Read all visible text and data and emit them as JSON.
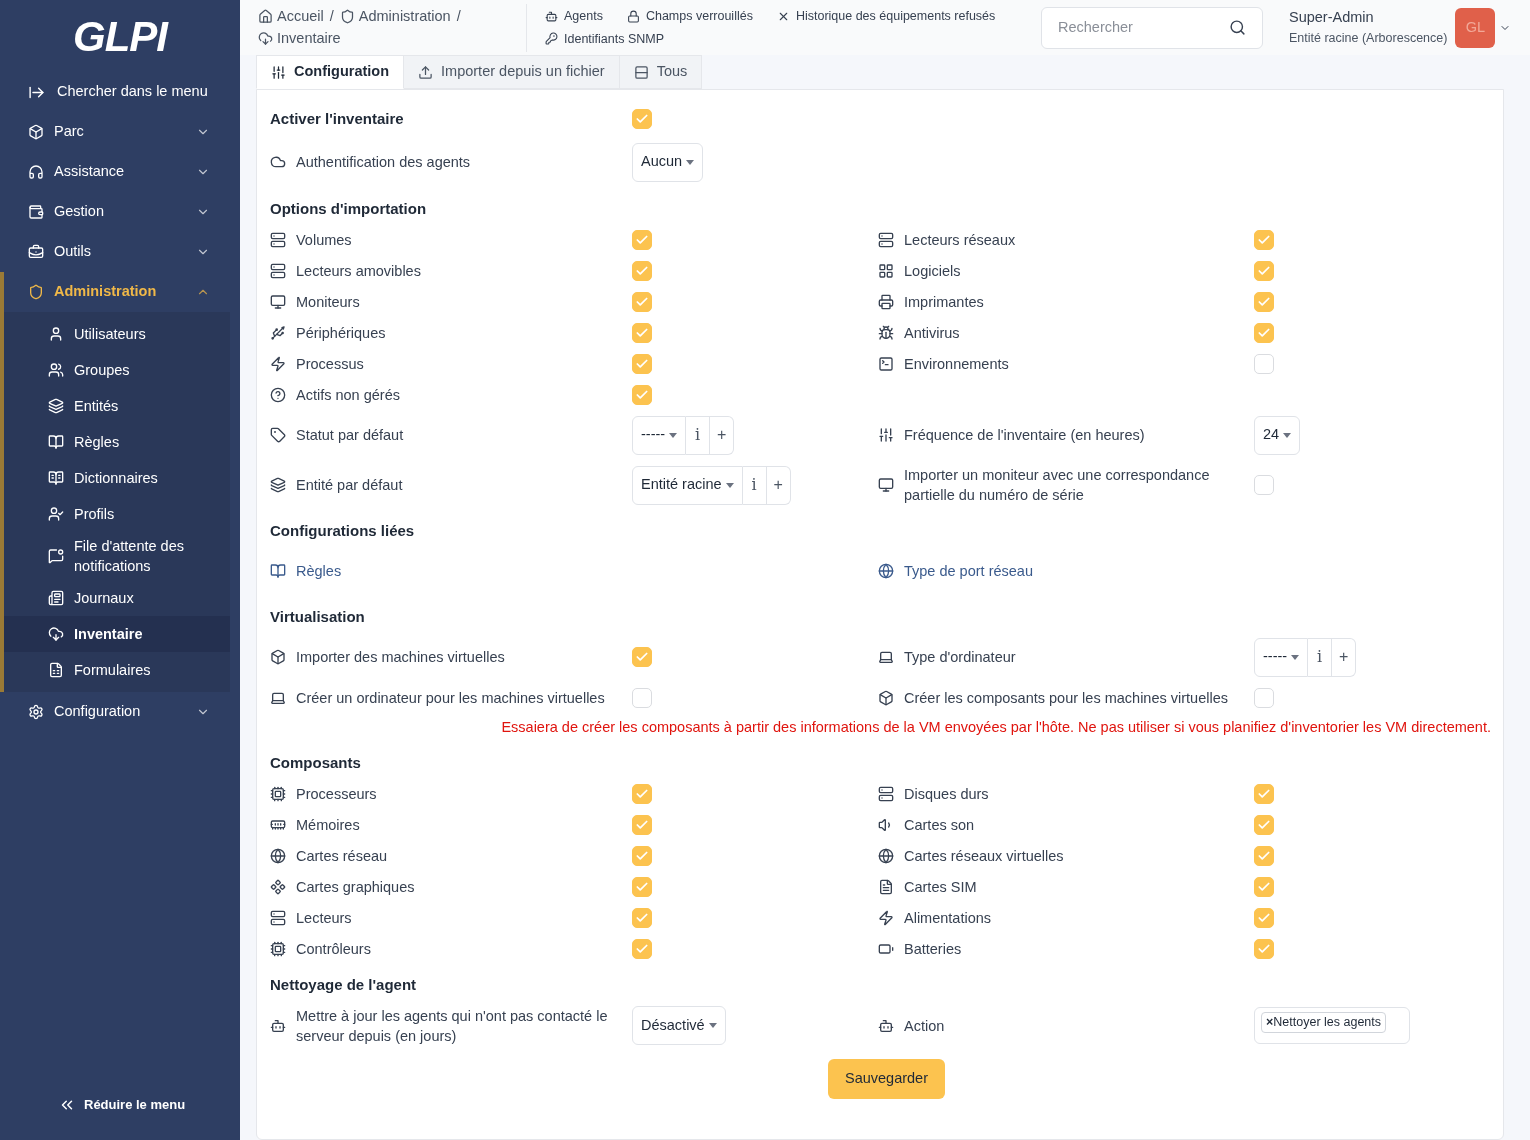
{
  "sidebar": {
    "logo": "GLPI",
    "search_label": "Chercher dans le menu",
    "items": [
      {
        "label": "Parc",
        "selected": false,
        "expanded": false
      },
      {
        "label": "Assistance",
        "selected": false,
        "expanded": false
      },
      {
        "label": "Gestion",
        "selected": false,
        "expanded": false
      },
      {
        "label": "Outils",
        "selected": false,
        "expanded": false
      },
      {
        "label": "Administration",
        "selected": true,
        "expanded": true,
        "children": [
          {
            "label": "Utilisateurs",
            "selected": false
          },
          {
            "label": "Groupes",
            "selected": false
          },
          {
            "label": "Entités",
            "selected": false
          },
          {
            "label": "Règles",
            "selected": false
          },
          {
            "label": "Dictionnaires",
            "selected": false
          },
          {
            "label": "Profils",
            "selected": false
          },
          {
            "label": "File d'attente des notifications",
            "selected": false
          },
          {
            "label": "Journaux",
            "selected": false
          },
          {
            "label": "Inventaire",
            "selected": true
          },
          {
            "label": "Formulaires",
            "selected": false
          }
        ]
      },
      {
        "label": "Configuration",
        "selected": false,
        "expanded": false
      }
    ],
    "collapse_label": "Réduire le menu"
  },
  "header": {
    "breadcrumbs": [
      "Accueil",
      "Administration",
      "Inventaire"
    ],
    "separator": "/",
    "links": [
      "Agents",
      "Champs verrouillés",
      "Historique des équipements refusés",
      "Identifiants SNMP"
    ],
    "search": {
      "placeholder": "Rechercher"
    },
    "user": {
      "name": "Super-Admin",
      "entity": "Entité racine (Arborescence)",
      "initials": "GL"
    }
  },
  "tabs": [
    {
      "label": "Configuration",
      "selected": true
    },
    {
      "label": "Importer depuis un fichier",
      "selected": false
    },
    {
      "label": "Tous",
      "selected": false
    }
  ],
  "form": {
    "enable": {
      "label": "Activer l'inventaire",
      "checked": true
    },
    "sections": [
      {
        "rows": [
          [
            {
              "kind": "select",
              "label": "Authentification des agents",
              "value": "Aucun"
            }
          ]
        ]
      },
      {
        "title": "Options d'importation",
        "rows": [
          [
            {
              "kind": "checkbox",
              "label": "Volumes",
              "checked": true
            },
            {
              "kind": "checkbox",
              "label": "Lecteurs réseaux",
              "checked": true
            }
          ],
          [
            {
              "kind": "checkbox",
              "label": "Lecteurs amovibles",
              "checked": true
            },
            {
              "kind": "checkbox",
              "label": "Logiciels",
              "checked": true
            }
          ],
          [
            {
              "kind": "checkbox",
              "label": "Moniteurs",
              "checked": true
            },
            {
              "kind": "checkbox",
              "label": "Imprimantes",
              "checked": true
            }
          ],
          [
            {
              "kind": "checkbox",
              "label": "Périphériques",
              "checked": true
            },
            {
              "kind": "checkbox",
              "label": "Antivirus",
              "checked": true
            }
          ],
          [
            {
              "kind": "checkbox",
              "label": "Processus",
              "checked": true
            },
            {
              "kind": "checkbox",
              "label": "Environnements",
              "checked": false
            }
          ],
          [
            {
              "kind": "checkbox",
              "label": "Actifs non gérés",
              "checked": true
            }
          ],
          [
            {
              "kind": "select_plus",
              "label": "Statut par défaut",
              "value": "-----",
              "buttons": [
                "i",
                "+"
              ]
            },
            {
              "kind": "select",
              "label": "Fréquence de l'inventaire (en heures)",
              "value": "24"
            }
          ],
          [
            {
              "kind": "select_plus",
              "label": "Entité par défaut",
              "value": "Entité racine",
              "buttons": [
                "i",
                "+"
              ]
            },
            {
              "kind": "checkbox",
              "label": "Importer un moniteur avec une correspondance partielle du numéro de série",
              "checked": false
            }
          ]
        ]
      },
      {
        "title": "Configurations liées",
        "rows": [
          [
            {
              "kind": "link",
              "label": "Règles"
            },
            {
              "kind": "link",
              "label": "Type de port réseau"
            }
          ]
        ]
      },
      {
        "title": "Virtualisation",
        "rows": [
          [
            {
              "kind": "checkbox",
              "label": "Importer des machines virtuelles",
              "checked": true
            },
            {
              "kind": "select_plus",
              "label": "Type d'ordinateur",
              "value": "-----",
              "buttons": [
                "i",
                "+"
              ]
            }
          ],
          [
            {
              "kind": "checkbox",
              "label": "Créer un ordinateur pour les machines virtuelles",
              "checked": false
            },
            {
              "kind": "checkbox",
              "label": "Créer les composants pour les machines virtuelles",
              "checked": false
            }
          ]
        ],
        "note": "Essaiera de créer les composants à partir des informations de la VM envoyées par l'hôte. Ne pas utiliser si vous planifiez d'inventorier les VM directement."
      },
      {
        "title": "Composants",
        "rows": [
          [
            {
              "kind": "checkbox",
              "label": "Processeurs",
              "checked": true
            },
            {
              "kind": "checkbox",
              "label": "Disques durs",
              "checked": true
            }
          ],
          [
            {
              "kind": "checkbox",
              "label": "Mémoires",
              "checked": true
            },
            {
              "kind": "checkbox",
              "label": "Cartes son",
              "checked": true
            }
          ],
          [
            {
              "kind": "checkbox",
              "label": "Cartes réseau",
              "checked": true
            },
            {
              "kind": "checkbox",
              "label": "Cartes réseaux virtuelles",
              "checked": true
            }
          ],
          [
            {
              "kind": "checkbox",
              "label": "Cartes graphiques",
              "checked": true
            },
            {
              "kind": "checkbox",
              "label": "Cartes SIM",
              "checked": true
            }
          ],
          [
            {
              "kind": "checkbox",
              "label": "Lecteurs",
              "checked": true
            },
            {
              "kind": "checkbox",
              "label": "Alimentations",
              "checked": true
            }
          ],
          [
            {
              "kind": "checkbox",
              "label": "Contrôleurs",
              "checked": true
            },
            {
              "kind": "checkbox",
              "label": "Batteries",
              "checked": true
            }
          ]
        ]
      },
      {
        "title": "Nettoyage de l'agent",
        "rows": [
          [
            {
              "kind": "select",
              "label": "Mettre à jour les agents qui n'ont pas contacté le serveur depuis (en jours)",
              "value": "Désactivé"
            },
            {
              "kind": "tags",
              "label": "Action",
              "remove": "×",
              "tags": [
                "Nettoyer les agents"
              ]
            }
          ]
        ]
      }
    ],
    "save": "Sauvegarder"
  }
}
